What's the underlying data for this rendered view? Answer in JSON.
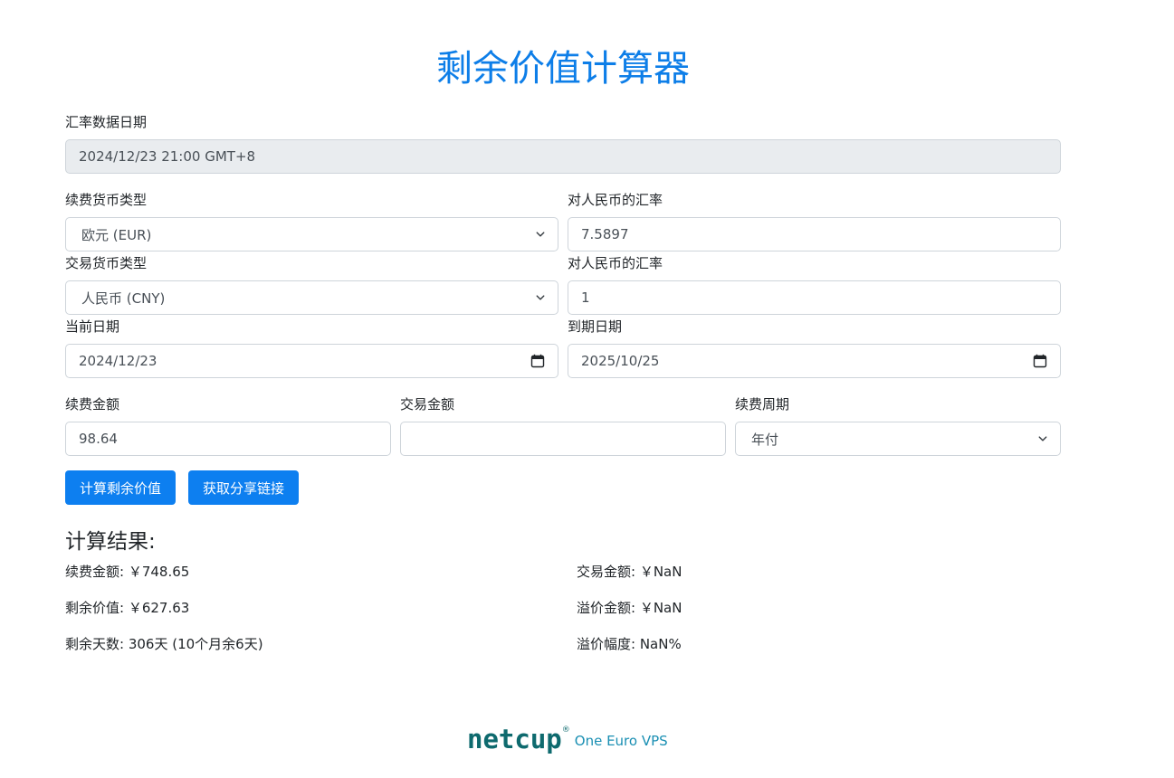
{
  "page": {
    "title": "剩余价值计算器"
  },
  "form": {
    "rate_date_label": "汇率数据日期",
    "rate_date_value": "2024/12/23 21:00 GMT+8",
    "renew_currency_label": "续费货币类型",
    "renew_currency_value": "欧元 (EUR)",
    "renew_rate_label": "对人民币的汇率",
    "renew_rate_value": "7.5897",
    "trade_currency_label": "交易货币类型",
    "trade_currency_value": "人民币 (CNY)",
    "trade_rate_label": "对人民币的汇率",
    "trade_rate_value": "1",
    "current_date_label": "当前日期",
    "current_date_value": "2024/12/23",
    "expire_date_label": "到期日期",
    "expire_date_value": "2025/10/25",
    "renew_amount_label": "续费金额",
    "renew_amount_value": "98.64",
    "trade_amount_label": "交易金额",
    "trade_amount_value": "",
    "renew_period_label": "续费周期",
    "renew_period_value": "年付"
  },
  "buttons": {
    "calculate": "计算剩余价值",
    "share": "获取分享链接"
  },
  "results": {
    "title": "计算结果:",
    "renew_amount": "续费金额: ￥748.65",
    "remaining_value": "剩余价值: ￥627.63",
    "remaining_days": "剩余天数: 306天 (10个月余6天)",
    "trade_amount": "交易金额: ￥NaN",
    "premium_amount": "溢价金额: ￥NaN",
    "premium_rate": "溢价幅度: NaN%"
  },
  "footer": {
    "logo": "netcup",
    "registered": "®",
    "tagline": "One Euro VPS"
  },
  "icons": {
    "select": "chevron-down-icon",
    "date": "calendar-icon"
  },
  "colors": {
    "title": "#0d7ee8",
    "button": "#0d7ff0",
    "logo": "#0e6a6e",
    "tagline": "#1a8fb3"
  }
}
